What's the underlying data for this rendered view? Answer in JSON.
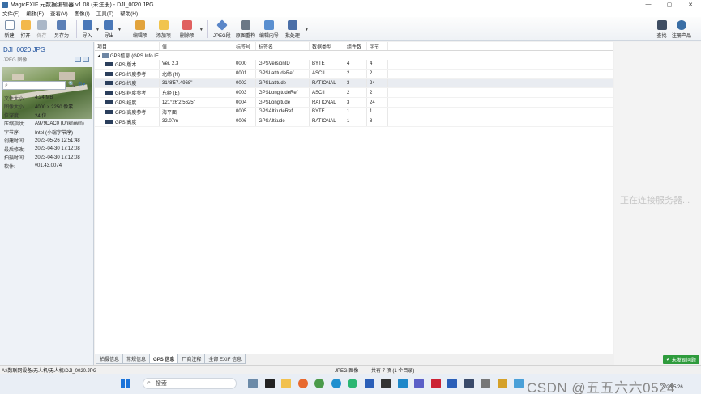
{
  "window": {
    "title": "MagicEXIF 元数据编辑器 v1.08 (未注册) - DJI_0020.JPG",
    "controls": {
      "minimize": "—",
      "maximize": "▢",
      "close": "✕"
    }
  },
  "menu": [
    "文件(F)",
    "编辑(E)",
    "查看(V)",
    "图像(I)",
    "工具(T)",
    "帮助(H)"
  ],
  "toolbar": {
    "new": "新建",
    "open": "打开",
    "save": "保存",
    "save_as": "另存为",
    "import": "导入",
    "export": "导出",
    "edit_item": "编辑项",
    "add_item": "添加项",
    "delete_item": "删除项",
    "jpeg_seg": "JPEG段",
    "reconstruct": "原图重构",
    "edit_wizard": "编辑向导",
    "batch": "批处理",
    "find": "查找",
    "register": "注册产品"
  },
  "left": {
    "filename": "DJI_0020.JPG",
    "filetype": "JPEG 图像",
    "search_placeholder": "",
    "properties": [
      {
        "k": "文件大小:",
        "v": "4.24 MB"
      },
      {
        "k": "图像大小:",
        "v": "4000 × 2250 像素"
      },
      {
        "k": "位深度:",
        "v": "24 位"
      },
      {
        "k": "压缩指纹:",
        "v": "A979DAC0 (Unknown)"
      },
      {
        "k": "字节序:",
        "v": "Intel (小端字节序)"
      },
      {
        "k": "创建时间:",
        "v": "2023-05-26 12:51:48"
      },
      {
        "k": "最后修改:",
        "v": "2023-04-30 17:12:08"
      },
      {
        "k": "拍摄时间:",
        "v": "2023-04-30 17:12:08"
      },
      {
        "k": "软件:",
        "v": "v01.43.0074"
      }
    ]
  },
  "grid": {
    "headers": [
      "项目",
      "值",
      "标签号",
      "标签名",
      "数据类型",
      "组件数",
      "字节"
    ],
    "group": "GPS信息 (GPS Info IF...",
    "rows": [
      {
        "item": "GPS 版本",
        "value": "Ver. 2.3",
        "tag": "0000",
        "name": "GPSVersionID",
        "type": "BYTE",
        "count": "4",
        "bytes": "4"
      },
      {
        "item": "GPS 纬度参考",
        "value": "北纬 (N)",
        "tag": "0001",
        "name": "GPSLatitudeRef",
        "type": "ASCII",
        "count": "2",
        "bytes": "2"
      },
      {
        "item": "GPS 纬度",
        "value": "31°8'57.4968\"",
        "tag": "0002",
        "name": "GPSLatitude",
        "type": "RATIONAL",
        "count": "3",
        "bytes": "24"
      },
      {
        "item": "GPS 经度参考",
        "value": "东经 (E)",
        "tag": "0003",
        "name": "GPSLongitudeRef",
        "type": "ASCII",
        "count": "2",
        "bytes": "2"
      },
      {
        "item": "GPS 经度",
        "value": "121°26'2.5625\"",
        "tag": "0004",
        "name": "GPSLongitude",
        "type": "RATIONAL",
        "count": "3",
        "bytes": "24"
      },
      {
        "item": "GPS 高度参考",
        "value": "海平面",
        "tag": "0005",
        "name": "GPSAltitudeRef",
        "type": "BYTE",
        "count": "1",
        "bytes": "1"
      },
      {
        "item": "GPS 高度",
        "value": "32.07m",
        "tag": "0006",
        "name": "GPSAltitude",
        "type": "RATIONAL",
        "count": "1",
        "bytes": "8"
      }
    ]
  },
  "tabs": [
    "拍摄信息",
    "常规信息",
    "GPS 信息",
    "厂商注释",
    "全部 EXIF 信息"
  ],
  "right": {
    "connecting": "正在连接服务器...",
    "unpublished": "未发现问题"
  },
  "status": {
    "path": "A:\\数联网设备\\无人机\\无人机\\DJI_0020.JPG",
    "filetype": "JPEG 图像",
    "count": "共有 7 项 (1 个目录)"
  },
  "taskbar": {
    "search": "搜索",
    "watermark": "CSDN @五五六六0524",
    "date": "2023/5/26"
  },
  "colors": {
    "accent": "#1c4f9c",
    "ok_green": "#2e9b3c",
    "taskbar_bg": "#e9eef5"
  }
}
